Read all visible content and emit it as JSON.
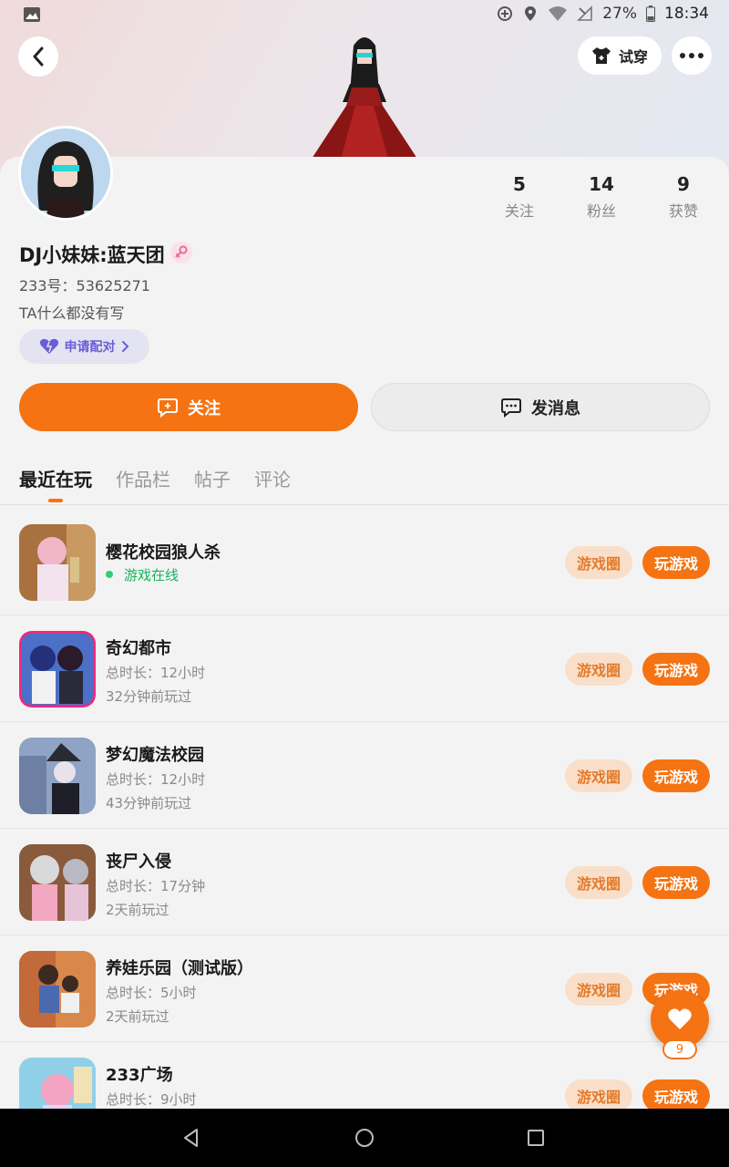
{
  "status_bar": {
    "battery": "27%",
    "time": "18:34"
  },
  "header": {
    "tryon_label": "试穿"
  },
  "profile": {
    "name": "DJ小妹妹:蓝天团",
    "uid": "233号：53625271",
    "bio": "TA什么都没有写",
    "pair_label": "申请配对",
    "stats": [
      {
        "num": "5",
        "label": "关注"
      },
      {
        "num": "14",
        "label": "粉丝"
      },
      {
        "num": "9",
        "label": "获赞"
      }
    ]
  },
  "actions": {
    "follow_label": "关注",
    "message_label": "发消息"
  },
  "tabs": [
    {
      "label": "最近在玩",
      "active": true
    },
    {
      "label": "作品栏",
      "active": false
    },
    {
      "label": "帖子",
      "active": false
    },
    {
      "label": "评论",
      "active": false
    }
  ],
  "games": [
    {
      "title": "樱花校园狼人杀",
      "line1": "游戏在线",
      "line2": "",
      "circle_label": "游戏圈",
      "play_label": "玩游戏"
    },
    {
      "title": "奇幻都市",
      "line1": "总时长：12小时",
      "line2": "32分钟前玩过",
      "circle_label": "游戏圈",
      "play_label": "玩游戏"
    },
    {
      "title": "梦幻魔法校园",
      "line1": "总时长：12小时",
      "line2": "43分钟前玩过",
      "circle_label": "游戏圈",
      "play_label": "玩游戏"
    },
    {
      "title": "丧尸入侵",
      "line1": "总时长：17分钟",
      "line2": "2天前玩过",
      "circle_label": "游戏圈",
      "play_label": "玩游戏"
    },
    {
      "title": "养娃乐园（测试版）",
      "line1": "总时长：5小时",
      "line2": "2天前玩过",
      "circle_label": "游戏圈",
      "play_label": "玩游戏"
    },
    {
      "title": "233广场",
      "line1": "总时长：9小时",
      "line2": "",
      "circle_label": "游戏圈",
      "play_label": "玩游戏"
    }
  ],
  "fab": {
    "count": "9"
  },
  "colors": {
    "accent": "#f57312",
    "online": "#17b35c",
    "pair": "#6a5ed6"
  }
}
